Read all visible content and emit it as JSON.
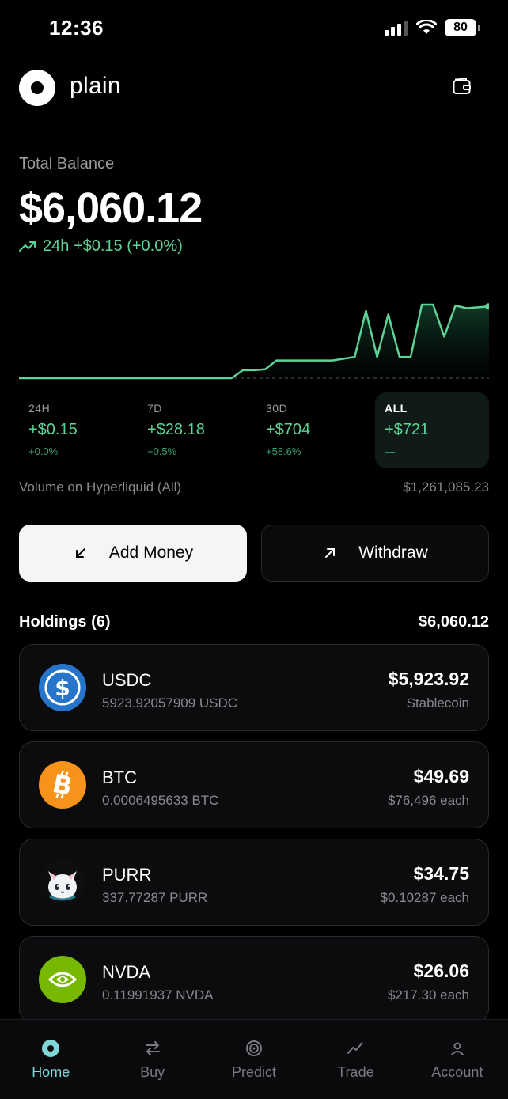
{
  "status": {
    "time": "12:36",
    "battery": "80"
  },
  "header": {
    "brand": "plain"
  },
  "balance": {
    "label": "Total Balance",
    "value": "$6,060.12",
    "change": "24h +$0.15 (+0.0%)"
  },
  "chart_data": {
    "type": "area",
    "title": "",
    "series": [
      {
        "values": [
          0,
          0,
          0,
          0,
          0,
          0,
          0,
          0,
          0,
          0,
          0,
          0,
          0,
          0,
          0,
          0,
          0,
          0,
          0,
          0,
          0.09,
          0.09,
          0.1,
          0.2,
          0.2,
          0.2,
          0.2,
          0.2,
          0.2,
          0.22,
          0.24,
          0.76,
          0.24,
          0.72,
          0.24,
          0.24,
          0.83,
          0.83,
          0.47,
          0.82,
          0.79,
          0.8,
          0.81
        ]
      }
    ],
    "baseline": 0,
    "accent": "#5fd396"
  },
  "periods": [
    {
      "label": "24H",
      "value": "+$0.15",
      "pct": "+0.0%"
    },
    {
      "label": "7D",
      "value": "+$28.18",
      "pct": "+0.5%"
    },
    {
      "label": "30D",
      "value": "+$704",
      "pct": "+58.6%"
    },
    {
      "label": "ALL",
      "value": "+$721",
      "pct": "—"
    }
  ],
  "volume": {
    "label": "Volume on Hyperliquid (All)",
    "value": "$1,261,085.23"
  },
  "actions": {
    "add": "Add Money",
    "withdraw": "Withdraw"
  },
  "holdings": {
    "title": "Holdings (6)",
    "total": "$6,060.12",
    "items": [
      {
        "name": "USDC",
        "amount": "5923.92057909 USDC",
        "value": "$5,923.92",
        "note": "Stablecoin",
        "icon": "usdc-icon",
        "color": "#2775ca"
      },
      {
        "name": "BTC",
        "amount": "0.0006495633 BTC",
        "value": "$49.69",
        "note": "$76,496 each",
        "icon": "bitcoin-icon",
        "color": "#f7931a"
      },
      {
        "name": "PURR",
        "amount": "337.77287 PURR",
        "value": "$34.75",
        "note": "$0.10287 each",
        "icon": "purr-cat-icon",
        "color": "#0e0e10"
      },
      {
        "name": "NVDA",
        "amount": "0.11991937 NVDA",
        "value": "$26.06",
        "note": "$217.30 each",
        "icon": "nvidia-icon",
        "color": "#76b900"
      }
    ]
  },
  "tabs": [
    {
      "label": "Home",
      "icon": "home-dot-icon"
    },
    {
      "label": "Buy",
      "icon": "swap-icon"
    },
    {
      "label": "Predict",
      "icon": "target-icon"
    },
    {
      "label": "Trade",
      "icon": "trend-icon"
    },
    {
      "label": "Account",
      "icon": "person-icon"
    }
  ]
}
